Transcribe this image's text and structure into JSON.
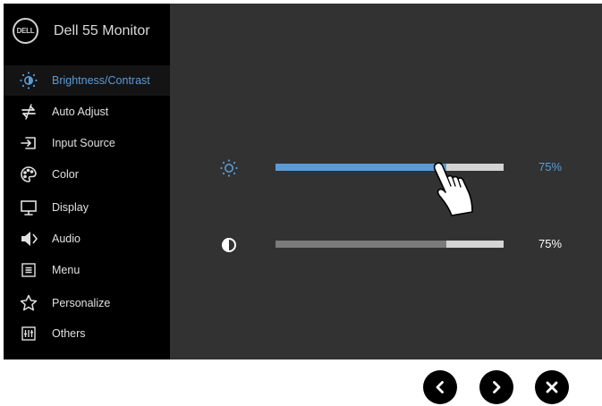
{
  "app": {
    "logo_text": "DELL",
    "title": "Dell 55 Monitor"
  },
  "colors": {
    "accent": "#5b9bd5",
    "osd_background": "#323232",
    "sidebar_background": "#000000"
  },
  "sidebar": {
    "items": [
      {
        "label": "Brightness/Contrast",
        "icon": "brightness-icon",
        "active": true
      },
      {
        "label": "Auto Adjust",
        "icon": "auto-adjust-icon"
      },
      {
        "label": "Input Source",
        "icon": "input-source-icon"
      },
      {
        "label": "Color",
        "icon": "color-palette-icon"
      },
      {
        "label": "Display",
        "icon": "display-icon"
      },
      {
        "label": "Audio",
        "icon": "speaker-icon"
      },
      {
        "label": "Menu",
        "icon": "menu-icon"
      },
      {
        "label": "Personalize",
        "icon": "star-icon"
      },
      {
        "label": "Others",
        "icon": "others-icon"
      }
    ]
  },
  "controls": {
    "brightness": {
      "icon": "brightness-icon",
      "value": 75,
      "value_label": "75%",
      "selected": true
    },
    "contrast": {
      "icon": "contrast-icon",
      "value": 75,
      "value_label": "75%"
    }
  },
  "navigation": [
    "chevron-left-icon",
    "chevron-right-icon",
    "close-icon"
  ]
}
